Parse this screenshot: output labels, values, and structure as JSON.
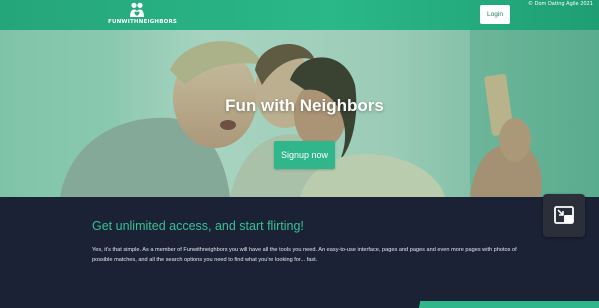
{
  "header": {
    "logo_text": "FUNWITHNEIGHBORS",
    "login_label": "Login"
  },
  "watermark": "© Dom Dating Agile 2021",
  "hero": {
    "title": "Fun with Neighbors",
    "signup_label": "Signup now"
  },
  "info": {
    "heading": "Get unlimited access, and start flirting!",
    "body": "Yes, it's that simple. As a member of Funwithneighbors you will have all the tools you need. An easy-to-use interface, pages and pages and even more pages with photos of possible matches, and all the search options you need to find what you're looking for... fast."
  },
  "colors": {
    "brand_green": "#2fb68a",
    "header_green": "#25a57a",
    "dark_navy": "#1b2236"
  },
  "icons": {
    "logo": "couple-heart-icon",
    "pip": "picture-in-picture-exit-icon"
  }
}
